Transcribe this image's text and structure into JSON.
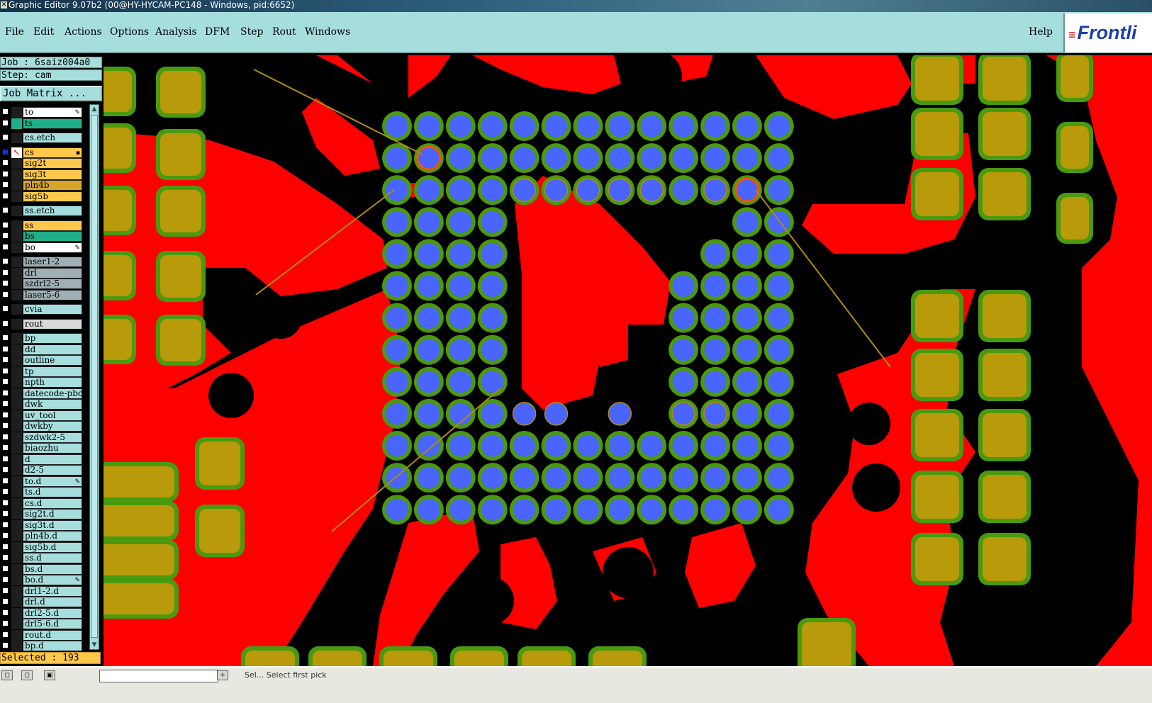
{
  "window": {
    "title": "Graphic Editor 9.07b2 (00@HY-HYCAM-PC148 - Windows, pid:6652)"
  },
  "menu": {
    "items": [
      {
        "label": "File"
      },
      {
        "label": "Edit"
      },
      {
        "label": "Actions"
      },
      {
        "label": "Options"
      },
      {
        "label": "Analysis"
      },
      {
        "label": "DFM"
      },
      {
        "label": "Step"
      },
      {
        "label": "Rout"
      },
      {
        "label": "Windows"
      }
    ],
    "help": "Help",
    "logo": "Frontli"
  },
  "job": {
    "job_label": "Job : 6saiz004a0",
    "step_label": "Step: cam",
    "matrix_button": "Job Matrix ..."
  },
  "layers": [
    {
      "name": "to",
      "color": "#ffffff",
      "status": "dark",
      "mark": "✎"
    },
    {
      "name": "ts",
      "color": "#1fb08a",
      "status": "green",
      "mark": ""
    },
    {
      "name": "cs.etch",
      "color": "#a6dede",
      "status": "dark",
      "mark": ""
    },
    {
      "name": "cs",
      "color": "#ffc84a",
      "status": "work",
      "mark": "▪"
    },
    {
      "name": "sig2t",
      "color": "#ffc84a",
      "status": "dark",
      "mark": ""
    },
    {
      "name": "sig3t",
      "color": "#ffc84a",
      "status": "dark",
      "mark": ""
    },
    {
      "name": "pln4b",
      "color": "#d6a52a",
      "status": "dark",
      "mark": ""
    },
    {
      "name": "sig5b",
      "color": "#ffc84a",
      "status": "dark",
      "mark": ""
    },
    {
      "name": "ss.etch",
      "color": "#a6dede",
      "status": "dark",
      "mark": ""
    },
    {
      "name": "ss",
      "color": "#ffc84a",
      "status": "dark",
      "mark": ""
    },
    {
      "name": "bs",
      "color": "#1fb08a",
      "status": "dark",
      "mark": ""
    },
    {
      "name": "bo",
      "color": "#ffffff",
      "status": "dark",
      "mark": "✎"
    },
    {
      "name": "laser1-2",
      "color": "#9fb0b4",
      "status": "dark",
      "mark": ""
    },
    {
      "name": "drl",
      "color": "#9fb0b4",
      "status": "dark",
      "mark": ""
    },
    {
      "name": "szdrl2-5",
      "color": "#9fb0b4",
      "status": "dark",
      "mark": ""
    },
    {
      "name": "laser5-6",
      "color": "#9fb0b4",
      "status": "dark",
      "mark": ""
    },
    {
      "name": "cvia",
      "color": "#a6dede",
      "status": "dark",
      "mark": ""
    },
    {
      "name": "rout",
      "color": "#d8d8d8",
      "status": "dark",
      "mark": ""
    },
    {
      "name": "bp",
      "color": "#a6dede",
      "status": "dark",
      "mark": ""
    },
    {
      "name": "dd",
      "color": "#a6dede",
      "status": "dark",
      "mark": ""
    },
    {
      "name": "outline",
      "color": "#a6dede",
      "status": "dark",
      "mark": ""
    },
    {
      "name": "tp",
      "color": "#a6dede",
      "status": "dark",
      "mark": ""
    },
    {
      "name": "npth",
      "color": "#a6dede",
      "status": "dark",
      "mark": ""
    },
    {
      "name": "datecode-pbc",
      "color": "#a6dede",
      "status": "dark",
      "mark": ""
    },
    {
      "name": "dwk",
      "color": "#a6dede",
      "status": "dark",
      "mark": ""
    },
    {
      "name": "uv_tool",
      "color": "#a6dede",
      "status": "dark",
      "mark": ""
    },
    {
      "name": "dwkby",
      "color": "#a6dede",
      "status": "dark",
      "mark": ""
    },
    {
      "name": "szdwk2-5",
      "color": "#a6dede",
      "status": "dark",
      "mark": ""
    },
    {
      "name": "biaozhu",
      "color": "#a6dede",
      "status": "dark",
      "mark": ""
    },
    {
      "name": "d",
      "color": "#a6dede",
      "status": "dark",
      "mark": ""
    },
    {
      "name": "d2-5",
      "color": "#a6dede",
      "status": "dark",
      "mark": ""
    },
    {
      "name": "to.d",
      "color": "#a6dede",
      "status": "dark",
      "mark": "✎"
    },
    {
      "name": "ts.d",
      "color": "#a6dede",
      "status": "dark",
      "mark": ""
    },
    {
      "name": "cs.d",
      "color": "#a6dede",
      "status": "dark",
      "mark": ""
    },
    {
      "name": "sig2t.d",
      "color": "#a6dede",
      "status": "dark",
      "mark": ""
    },
    {
      "name": "sig3t.d",
      "color": "#a6dede",
      "status": "dark",
      "mark": ""
    },
    {
      "name": "pln4b.d",
      "color": "#a6dede",
      "status": "dark",
      "mark": ""
    },
    {
      "name": "sig5b.d",
      "color": "#a6dede",
      "status": "dark",
      "mark": ""
    },
    {
      "name": "ss.d",
      "color": "#a6dede",
      "status": "dark",
      "mark": ""
    },
    {
      "name": "bs.d",
      "color": "#a6dede",
      "status": "dark",
      "mark": ""
    },
    {
      "name": "bo.d",
      "color": "#a6dede",
      "status": "dark",
      "mark": "✎"
    },
    {
      "name": "drl1-2.d",
      "color": "#a6dede",
      "status": "dark",
      "mark": ""
    },
    {
      "name": "drl.d",
      "color": "#a6dede",
      "status": "dark",
      "mark": ""
    },
    {
      "name": "drl2-5.d",
      "color": "#a6dede",
      "status": "dark",
      "mark": ""
    },
    {
      "name": "drl5-6.d",
      "color": "#a6dede",
      "status": "dark",
      "mark": ""
    },
    {
      "name": "rout.d",
      "color": "#a6dede",
      "status": "dark",
      "mark": ""
    },
    {
      "name": "bp.d",
      "color": "#a6dede",
      "status": "dark",
      "mark": ""
    }
  ],
  "selection": {
    "label": "Selected : 193"
  },
  "status": {
    "message": "Sel... Select first pick"
  },
  "colors": {
    "copper": "#ff0000",
    "pad": "#b89a0a",
    "soldermask_ring": "#4a9a10",
    "via": "#4a64ff",
    "background": "#000000",
    "pointer": "#b08a10"
  }
}
